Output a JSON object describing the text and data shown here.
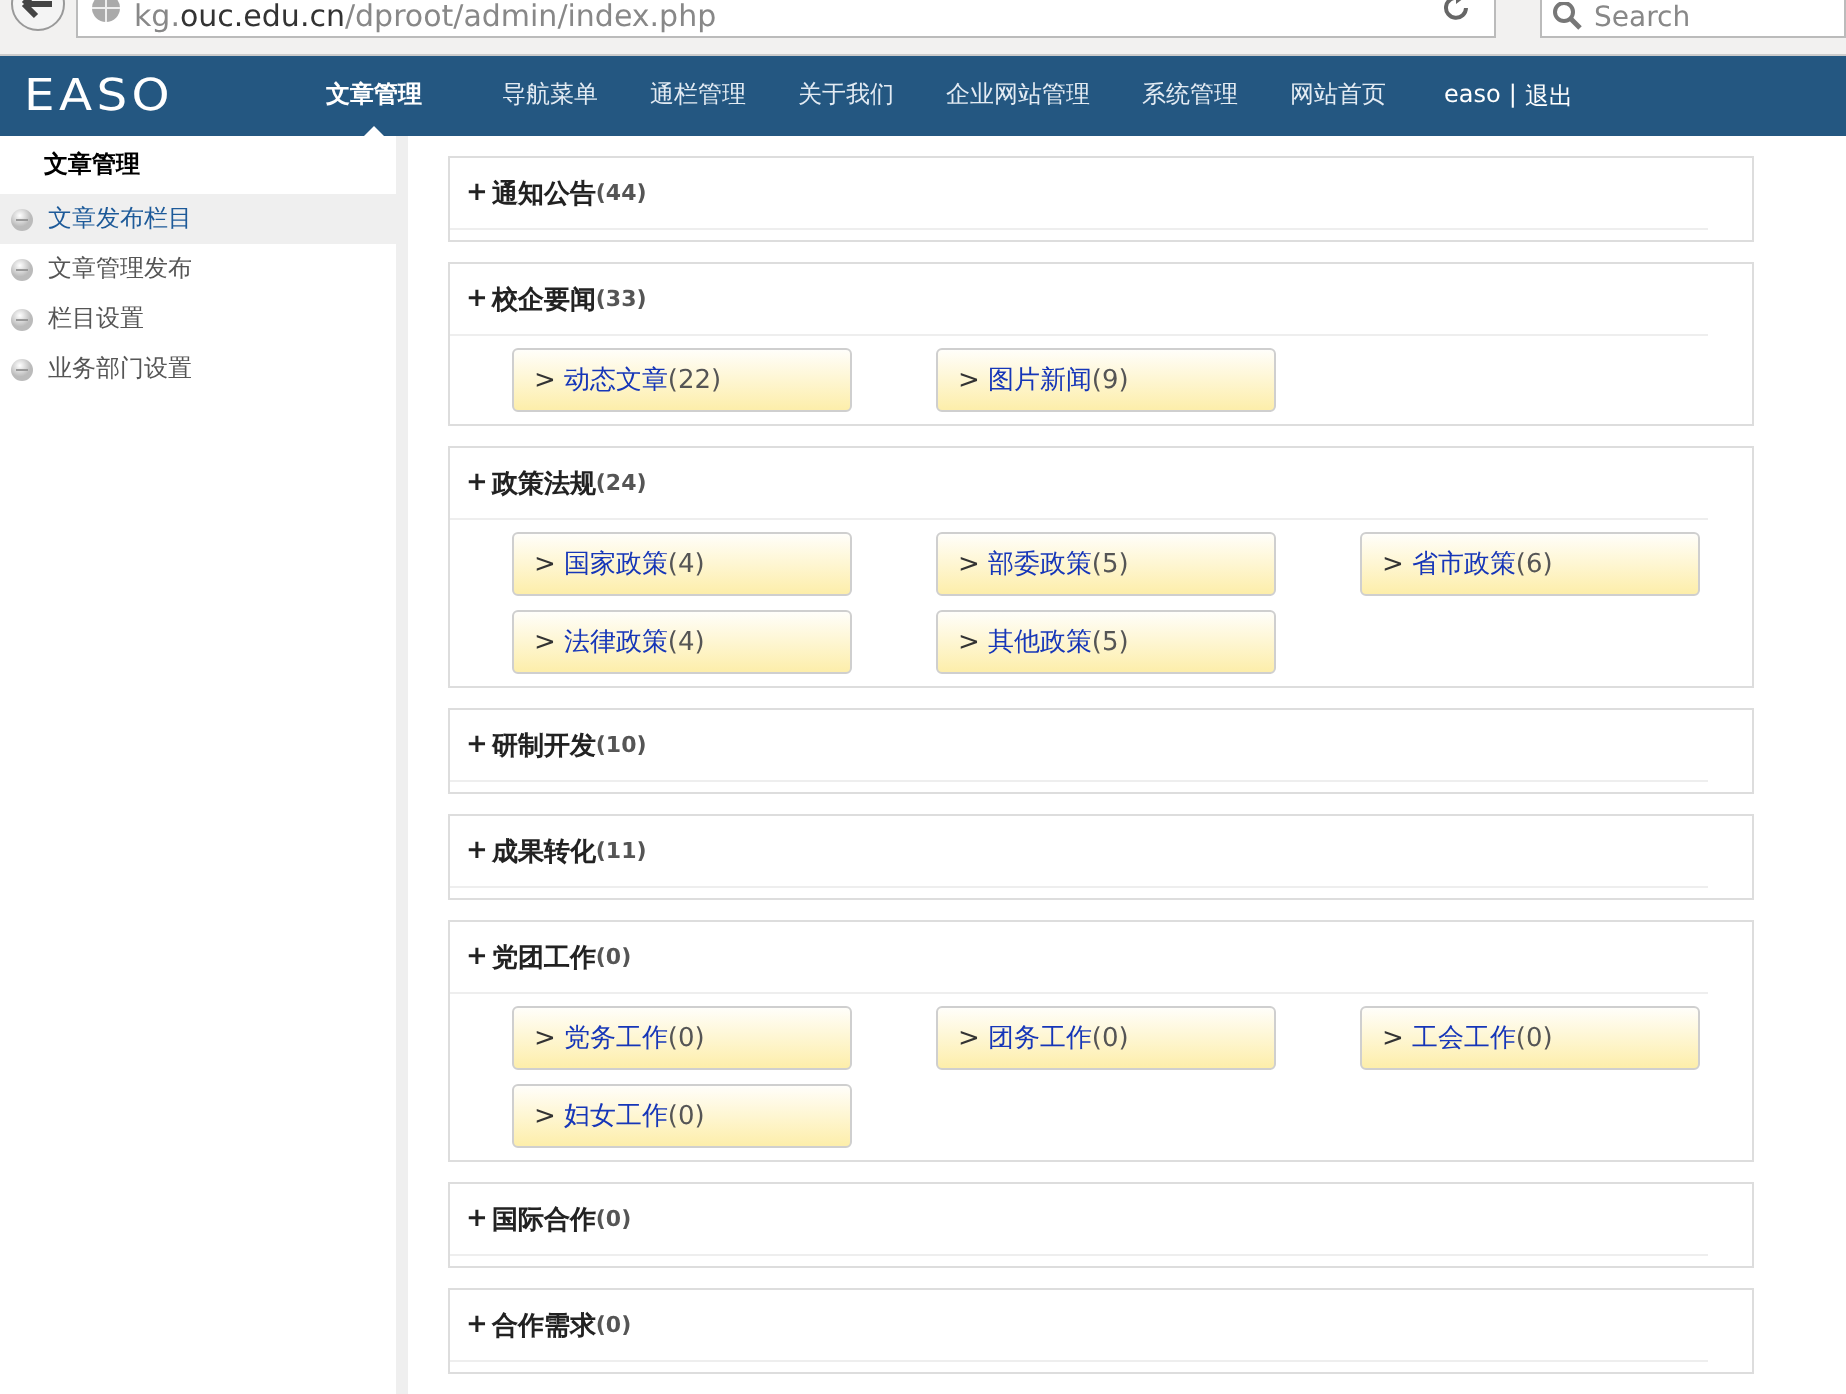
{
  "browser": {
    "url": {
      "sub": "kg.",
      "domain": "ouc.edu.cn",
      "path": "/dproot/admin/index.php"
    },
    "search": {
      "placeholder": "Search"
    }
  },
  "header": {
    "logo": "EASO",
    "nav": [
      {
        "label": "文章管理",
        "selected": true
      },
      {
        "label": "导航菜单",
        "selected": false
      },
      {
        "label": "通栏管理",
        "selected": false
      },
      {
        "label": "关于我们",
        "selected": false
      },
      {
        "label": "企业网站管理",
        "selected": false
      },
      {
        "label": "系统管理",
        "selected": false
      },
      {
        "label": "网站首页",
        "selected": false
      }
    ],
    "user": "easo",
    "separator": "|",
    "logout": "退出"
  },
  "sidebar": {
    "title": "文章管理",
    "items": [
      {
        "label": "文章发布栏目",
        "selected": true
      },
      {
        "label": "文章管理发布",
        "selected": false
      },
      {
        "label": "栏目设置",
        "selected": false
      },
      {
        "label": "业务部门设置",
        "selected": false
      }
    ]
  },
  "sections": [
    {
      "toggle": "+",
      "title": "通知公告",
      "count": "(44)"
    },
    {
      "toggle": "+",
      "title": "校企要闻",
      "count": "(33)",
      "links": [
        {
          "marker": ">",
          "name": "动态文章",
          "count": "(22)"
        },
        {
          "marker": ">",
          "name": "图片新闻",
          "count": "(9)"
        }
      ]
    },
    {
      "toggle": "+",
      "title": "政策法规",
      "count": "(24)",
      "links": [
        {
          "marker": ">",
          "name": "国家政策",
          "count": "(4)"
        },
        {
          "marker": ">",
          "name": "部委政策",
          "count": "(5)"
        },
        {
          "marker": ">",
          "name": "省市政策",
          "count": "(6)"
        },
        {
          "marker": ">",
          "name": "法律政策",
          "count": "(4)"
        },
        {
          "marker": ">",
          "name": "其他政策",
          "count": "(5)"
        }
      ]
    },
    {
      "toggle": "+",
      "title": "研制开发",
      "count": "(10)"
    },
    {
      "toggle": "+",
      "title": "成果转化",
      "count": "(11)"
    },
    {
      "toggle": "+",
      "title": "党团工作",
      "count": "(0)",
      "links": [
        {
          "marker": ">",
          "name": "党务工作",
          "count": "(0)"
        },
        {
          "marker": ">",
          "name": "团务工作",
          "count": "(0)"
        },
        {
          "marker": ">",
          "name": "工会工作",
          "count": "(0)"
        },
        {
          "marker": ">",
          "name": "妇女工作",
          "count": "(0)"
        }
      ]
    },
    {
      "toggle": "+",
      "title": "国际合作",
      "count": "(0)"
    },
    {
      "toggle": "+",
      "title": "合作需求",
      "count": "(0)"
    }
  ]
}
